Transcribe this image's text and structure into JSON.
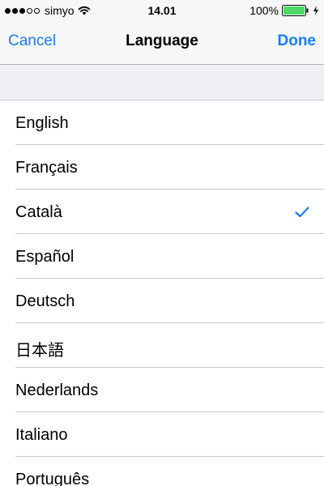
{
  "status_bar": {
    "signal_bars": 3,
    "signal_total": 5,
    "carrier": "simyo",
    "time": "14.01",
    "battery_text": "100%",
    "battery_level": 1.0,
    "battery_color": "#4cd964",
    "wifi_icon": "wifi-icon",
    "charging_icon": "bolt-icon"
  },
  "nav": {
    "cancel_label": "Cancel",
    "title": "Language",
    "done_label": "Done",
    "accent_color": "#157efb"
  },
  "languages": [
    {
      "label": "English",
      "selected": false
    },
    {
      "label": "Français",
      "selected": false
    },
    {
      "label": "Català",
      "selected": true
    },
    {
      "label": "Español",
      "selected": false
    },
    {
      "label": "Deutsch",
      "selected": false
    },
    {
      "label": "日本語",
      "selected": false
    },
    {
      "label": "Nederlands",
      "selected": false
    },
    {
      "label": "Italiano",
      "selected": false
    },
    {
      "label": "Português",
      "selected": false
    }
  ],
  "selected_indicator_icon": "checkmark-icon"
}
